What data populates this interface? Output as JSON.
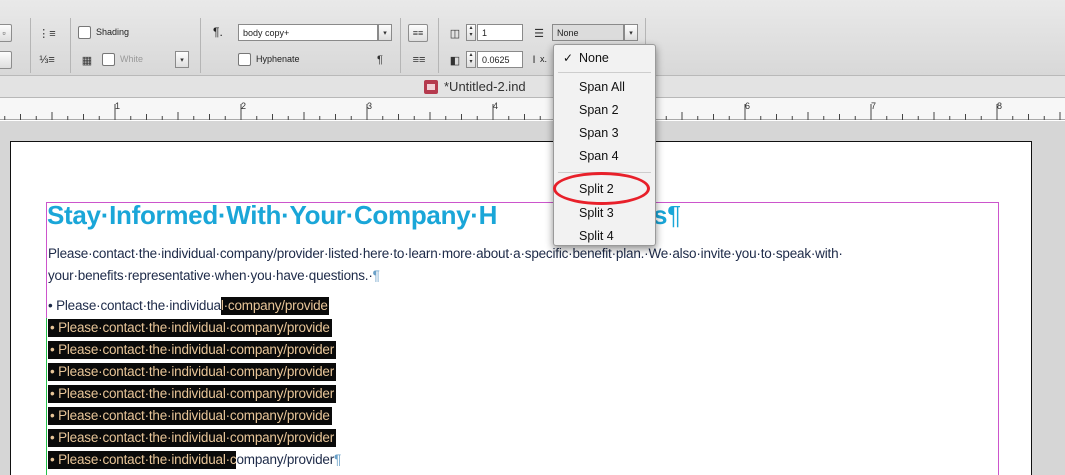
{
  "toolbar": {
    "shading_label": "Shading",
    "hyphenate_label": "Hyphenate",
    "paragraph_style": "body copy+",
    "color_field": "White",
    "columns_value": "1",
    "gutter_value": "0.0625",
    "span_columns_value": "None",
    "pilcrow_icon": "¶.",
    "gutter_unit": "x."
  },
  "document": {
    "title": "*Untitled-2.ind"
  },
  "ruler": {
    "numbers": [
      "1",
      "2",
      "3",
      "4",
      "5",
      "6",
      "7",
      "8"
    ]
  },
  "content": {
    "heading": "Stay·Informed·With·Your·Company·H",
    "heading_end": "efits",
    "heading_pilcrow": "¶",
    "paragraph_line1": "Please·contact·the·individual·company/provider·listed·here·to·learn·more·about·a·specific·benefit·plan.·We·also·invite·you·to·speak·with·",
    "paragraph_line2": "your·benefits·representative·when·you·have·questions.·",
    "paragraph_pilcrow": "¶",
    "bullets": [
      {
        "plain": "• Please·contact·the·individua",
        "sel": "l·company/provide"
      },
      {
        "plain": "",
        "sel": "• Please·contact·the·individual·company/provide"
      },
      {
        "plain": "",
        "sel": "• Please·contact·the·individual·company/provider"
      },
      {
        "plain": "",
        "sel": "• Please·contact·the·individual·company/provider"
      },
      {
        "plain": "",
        "sel": "• Please·contact·the·individual·company/provider"
      },
      {
        "plain": "",
        "sel": "• Please·contact·the·individual·company/provide"
      },
      {
        "plain": "",
        "sel": "• Please·contact·the·individual·company/provider"
      },
      {
        "plain": "",
        "sel": "• Please·contact·the·individual·c",
        "tail": "ompany/provider",
        "pilcrow": "¶"
      }
    ]
  },
  "span_menu": {
    "items": [
      {
        "label": "None",
        "checked": true
      },
      {
        "label": "Span All",
        "checked": false
      },
      {
        "label": "Span 2",
        "checked": false
      },
      {
        "label": "Span 3",
        "checked": false
      },
      {
        "label": "Span 4",
        "checked": false
      },
      {
        "label": "Split 2",
        "checked": false
      },
      {
        "label": "Split 3",
        "checked": false
      },
      {
        "label": "Split 4",
        "checked": false
      }
    ],
    "check_mark": "✓"
  },
  "colors": {
    "heading": "#1aa6d8",
    "selection_bg": "#0a0a0a",
    "selection_text": "#e8c598",
    "annotation_ring": "#e8202a"
  }
}
